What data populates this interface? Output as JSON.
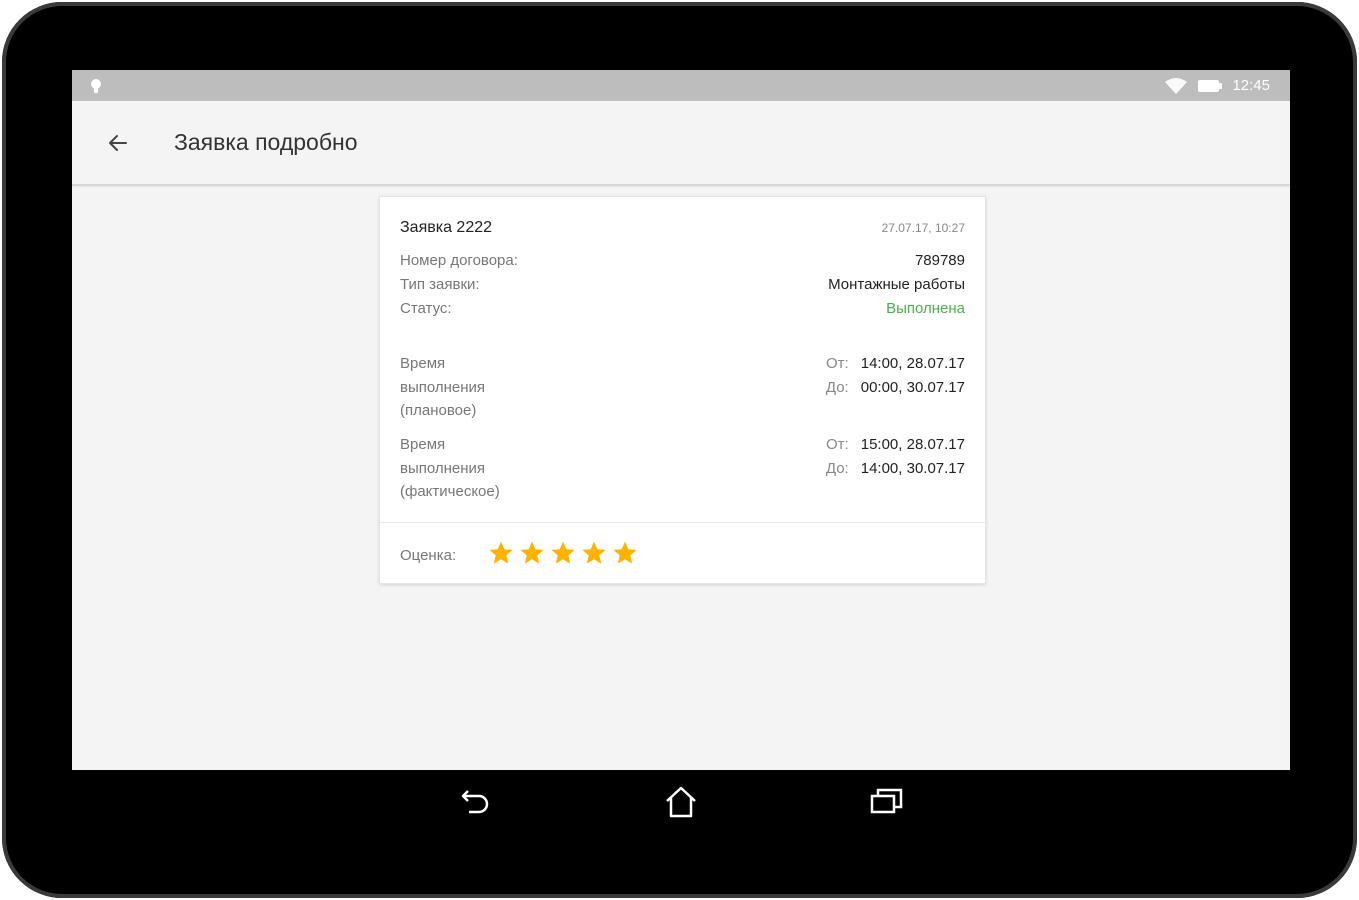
{
  "status_bar": {
    "time": "12:45",
    "icons": [
      "notification-icon",
      "wifi-icon",
      "battery-icon"
    ]
  },
  "toolbar": {
    "back_icon": "arrow-left-icon",
    "title": "Заявка подробно"
  },
  "order": {
    "title": "Заявка 2222",
    "datetime": "27.07.17, 10:27",
    "fields": [
      {
        "label": "Номер договора:",
        "value": "789789"
      },
      {
        "label": "Тип заявки:",
        "value": "Монтажные работы"
      },
      {
        "label": "Статус:",
        "value": "Выполнена"
      }
    ],
    "planned": {
      "label_lines": [
        "Время",
        "выполнения",
        "(плановое)"
      ],
      "from_prefix": "От:",
      "from": "14:00, 28.07.17",
      "to_prefix": "До:",
      "to": "00:00, 30.07.17"
    },
    "actual": {
      "label_lines": [
        "Время",
        "выполнения",
        "(фактическое)"
      ],
      "from_prefix": "От:",
      "from": "15:00, 28.07.17",
      "to_prefix": "До:",
      "to": "14:00, 30.07.17"
    },
    "rating": {
      "label": "Оценка:",
      "value": 5,
      "max": 5
    }
  },
  "colors": {
    "status_done": "#4caf50",
    "star": "#ffb300",
    "statusbar": "#bdbdbd",
    "background": "#f4f4f4"
  },
  "navigation": {
    "buttons": [
      "back-nav-icon",
      "home-icon",
      "recents-icon"
    ]
  }
}
